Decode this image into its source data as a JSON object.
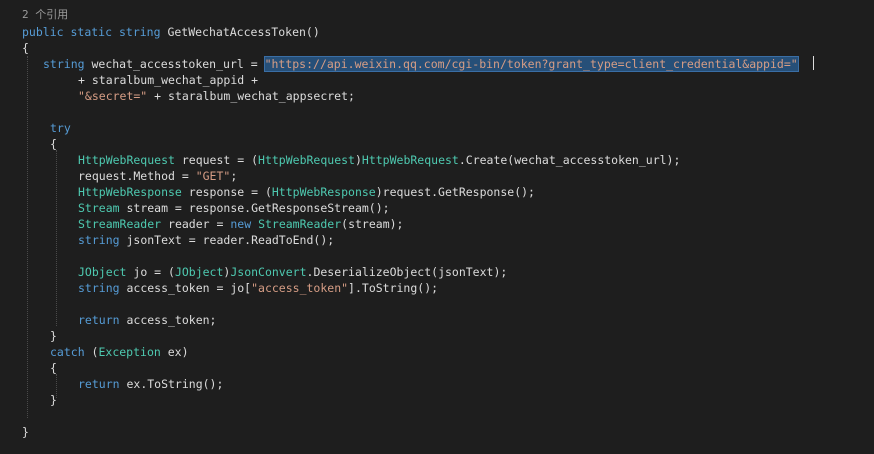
{
  "codelens": "2 个引用",
  "lines": [
    [
      [
        "kw",
        "public"
      ],
      [
        "pl",
        " "
      ],
      [
        "kw",
        "static"
      ],
      [
        "pl",
        " "
      ],
      [
        "kw",
        "string"
      ],
      [
        "pl",
        " GetWechatAccessToken()"
      ]
    ],
    [
      [
        "pl",
        "{"
      ]
    ],
    [
      [
        "kw",
        "string"
      ],
      [
        "pl",
        " wechat_accesstoken_url = "
      ],
      [
        "st sel",
        "\"https://api.weixin.qq.com/cgi-bin/token?grant_type=client_credential&appid=\""
      ]
    ],
    [
      [
        "pl",
        "+ staralbum_wechat_appid +"
      ]
    ],
    [
      [
        "st",
        "\"&secret=\""
      ],
      [
        "pl",
        " + staralbum_wechat_appsecret;"
      ]
    ],
    [
      [
        "kw",
        "try"
      ]
    ],
    [
      [
        "pl",
        "{"
      ]
    ],
    [
      [
        "ty",
        "HttpWebRequest"
      ],
      [
        "pl",
        " request = ("
      ],
      [
        "ty",
        "HttpWebRequest"
      ],
      [
        "pl",
        ")"
      ],
      [
        "ty",
        "HttpWebRequest"
      ],
      [
        "pl",
        ".Create(wechat_accesstoken_url);"
      ]
    ],
    [
      [
        "pl",
        "request.Method = "
      ],
      [
        "st",
        "\"GET\""
      ],
      [
        "pl",
        ";"
      ]
    ],
    [
      [
        "ty",
        "HttpWebResponse"
      ],
      [
        "pl",
        " response = ("
      ],
      [
        "ty",
        "HttpWebResponse"
      ],
      [
        "pl",
        ")request.GetResponse();"
      ]
    ],
    [
      [
        "ty",
        "Stream"
      ],
      [
        "pl",
        " stream = response.GetResponseStream();"
      ]
    ],
    [
      [
        "ty",
        "StreamReader"
      ],
      [
        "pl",
        " reader = "
      ],
      [
        "kw",
        "new"
      ],
      [
        "pl",
        " "
      ],
      [
        "ty",
        "StreamReader"
      ],
      [
        "pl",
        "(stream);"
      ]
    ],
    [
      [
        "kw",
        "string"
      ],
      [
        "pl",
        " jsonText = reader.ReadToEnd();"
      ]
    ],
    [
      [
        "ty",
        "JObject"
      ],
      [
        "pl",
        " jo = ("
      ],
      [
        "ty",
        "JObject"
      ],
      [
        "pl",
        ")"
      ],
      [
        "ty",
        "JsonConvert"
      ],
      [
        "pl",
        ".DeserializeObject(jsonText);"
      ]
    ],
    [
      [
        "kw",
        "string"
      ],
      [
        "pl",
        " access_token = jo["
      ],
      [
        "st",
        "\"access_token\""
      ],
      [
        "pl",
        "].ToString();"
      ]
    ],
    [
      [
        "kw",
        "return"
      ],
      [
        "pl",
        " access_token;"
      ]
    ],
    [
      [
        "pl",
        "}"
      ]
    ],
    [
      [
        "kw",
        "catch"
      ],
      [
        "pl",
        " ("
      ],
      [
        "ty",
        "Exception"
      ],
      [
        "pl",
        " ex)"
      ]
    ],
    [
      [
        "pl",
        "{"
      ]
    ],
    [
      [
        "kw",
        "return"
      ],
      [
        "pl",
        " ex.ToString();"
      ]
    ],
    [
      [
        "pl",
        "}"
      ]
    ],
    [
      [
        "pl",
        "}"
      ]
    ]
  ]
}
